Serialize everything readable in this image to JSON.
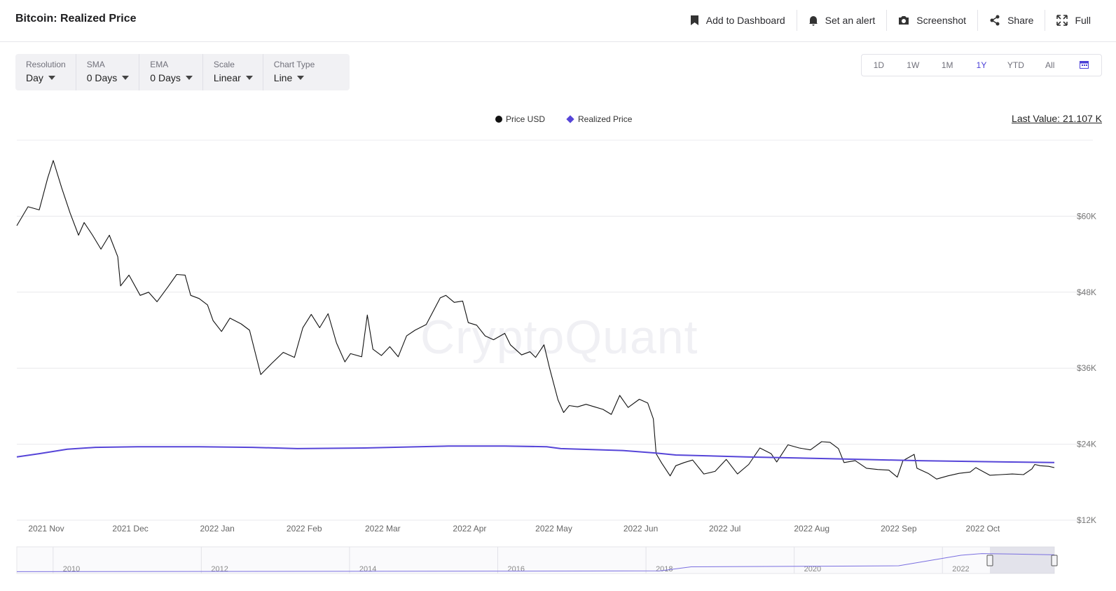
{
  "header": {
    "title": "Bitcoin: Realized Price",
    "actions": [
      {
        "label": "Add to Dashboard",
        "icon": "bookmark-icon"
      },
      {
        "label": "Set an alert",
        "icon": "bell-icon"
      },
      {
        "label": "Screenshot",
        "icon": "camera-icon"
      },
      {
        "label": "Share",
        "icon": "share-icon"
      },
      {
        "label": "Full",
        "icon": "expand-icon"
      }
    ]
  },
  "controls": [
    {
      "label": "Resolution",
      "value": "Day"
    },
    {
      "label": "SMA",
      "value": "0 Days"
    },
    {
      "label": "EMA",
      "value": "0 Days"
    },
    {
      "label": "Scale",
      "value": "Linear"
    },
    {
      "label": "Chart Type",
      "value": "Line"
    }
  ],
  "ranges": {
    "options": [
      "1D",
      "1W",
      "1M",
      "1Y",
      "YTD",
      "All"
    ],
    "active": "1Y",
    "calendar_icon": "calendar-icon",
    "accent": "#4a3fd6"
  },
  "legend": {
    "price": "Price USD",
    "realized": "Realized Price",
    "price_color": "#111111",
    "realized_color": "#5645d8"
  },
  "last_value": "Last Value: 21.107 K",
  "watermark": "CryptoQuant",
  "chart_data": {
    "type": "line",
    "x_ticks": [
      "2021 Nov",
      "2021 Dec",
      "2022 Jan",
      "2022 Feb",
      "2022 Mar",
      "2022 Apr",
      "2022 May",
      "2022 Jun",
      "2022 Jul",
      "2022 Aug",
      "2022 Sep",
      "2022 Oct"
    ],
    "y_ticks": [
      "$12K",
      "$24K",
      "$36K",
      "$48K",
      "$60K"
    ],
    "ylim": [
      12000,
      72000
    ],
    "x_range": [
      "2021-10-28",
      "2022-11-02"
    ],
    "grid": true,
    "legend_position": "top-center",
    "series": [
      {
        "name": "Price USD",
        "color": "#111111",
        "points": [
          [
            "2021-10-28",
            58500
          ],
          [
            "2021-11-01",
            61500
          ],
          [
            "2021-11-05",
            61000
          ],
          [
            "2021-11-08",
            66000
          ],
          [
            "2021-11-10",
            68800
          ],
          [
            "2021-11-13",
            64500
          ],
          [
            "2021-11-16",
            60500
          ],
          [
            "2021-11-19",
            57000
          ],
          [
            "2021-11-21",
            59000
          ],
          [
            "2021-11-24",
            57000
          ],
          [
            "2021-11-27",
            54800
          ],
          [
            "2021-11-30",
            57000
          ],
          [
            "2021-12-03",
            53600
          ],
          [
            "2021-12-04",
            49000
          ],
          [
            "2021-12-07",
            50700
          ],
          [
            "2021-12-11",
            47500
          ],
          [
            "2021-12-14",
            48000
          ],
          [
            "2021-12-17",
            46500
          ],
          [
            "2021-12-21",
            48900
          ],
          [
            "2021-12-24",
            50800
          ],
          [
            "2021-12-27",
            50700
          ],
          [
            "2021-12-29",
            47500
          ],
          [
            "2022-01-01",
            47000
          ],
          [
            "2022-01-04",
            46000
          ],
          [
            "2022-01-06",
            43500
          ],
          [
            "2022-01-09",
            41800
          ],
          [
            "2022-01-12",
            43900
          ],
          [
            "2022-01-16",
            43000
          ],
          [
            "2022-01-19",
            42000
          ],
          [
            "2022-01-21",
            38500
          ],
          [
            "2022-01-23",
            35000
          ],
          [
            "2022-01-27",
            36800
          ],
          [
            "2022-01-31",
            38500
          ],
          [
            "2022-02-04",
            37700
          ],
          [
            "2022-02-07",
            42400
          ],
          [
            "2022-02-10",
            44500
          ],
          [
            "2022-02-13",
            42400
          ],
          [
            "2022-02-16",
            44600
          ],
          [
            "2022-02-19",
            40000
          ],
          [
            "2022-02-22",
            37000
          ],
          [
            "2022-02-24",
            38300
          ],
          [
            "2022-02-28",
            37800
          ],
          [
            "2022-03-02",
            44400
          ],
          [
            "2022-03-04",
            39000
          ],
          [
            "2022-03-07",
            38000
          ],
          [
            "2022-03-10",
            39400
          ],
          [
            "2022-03-13",
            37800
          ],
          [
            "2022-03-16",
            41100
          ],
          [
            "2022-03-19",
            42000
          ],
          [
            "2022-03-23",
            42900
          ],
          [
            "2022-03-28",
            47100
          ],
          [
            "2022-03-30",
            47500
          ],
          [
            "2022-04-02",
            46400
          ],
          [
            "2022-04-05",
            46600
          ],
          [
            "2022-04-07",
            43200
          ],
          [
            "2022-04-10",
            42800
          ],
          [
            "2022-04-13",
            41100
          ],
          [
            "2022-04-16",
            40500
          ],
          [
            "2022-04-20",
            41500
          ],
          [
            "2022-04-22",
            39700
          ],
          [
            "2022-04-26",
            38100
          ],
          [
            "2022-04-29",
            38600
          ],
          [
            "2022-05-01",
            37700
          ],
          [
            "2022-05-04",
            39700
          ],
          [
            "2022-05-06",
            36000
          ],
          [
            "2022-05-09",
            31000
          ],
          [
            "2022-05-11",
            29000
          ],
          [
            "2022-05-13",
            30100
          ],
          [
            "2022-05-16",
            29900
          ],
          [
            "2022-05-19",
            30300
          ],
          [
            "2022-05-22",
            29900
          ],
          [
            "2022-05-25",
            29500
          ],
          [
            "2022-05-28",
            28700
          ],
          [
            "2022-05-31",
            31700
          ],
          [
            "2022-06-03",
            29800
          ],
          [
            "2022-06-07",
            31100
          ],
          [
            "2022-06-10",
            30500
          ],
          [
            "2022-06-12",
            28000
          ],
          [
            "2022-06-13",
            22500
          ],
          [
            "2022-06-15",
            21000
          ],
          [
            "2022-06-18",
            19000
          ],
          [
            "2022-06-20",
            20600
          ],
          [
            "2022-06-23",
            21100
          ],
          [
            "2022-06-26",
            21500
          ],
          [
            "2022-06-30",
            19300
          ],
          [
            "2022-07-04",
            19700
          ],
          [
            "2022-07-08",
            21600
          ],
          [
            "2022-07-12",
            19300
          ],
          [
            "2022-07-16",
            20800
          ],
          [
            "2022-07-20",
            23400
          ],
          [
            "2022-07-24",
            22500
          ],
          [
            "2022-07-26",
            21200
          ],
          [
            "2022-07-30",
            23900
          ],
          [
            "2022-08-03",
            23400
          ],
          [
            "2022-08-07",
            23100
          ],
          [
            "2022-08-11",
            24400
          ],
          [
            "2022-08-14",
            24300
          ],
          [
            "2022-08-17",
            23300
          ],
          [
            "2022-08-19",
            21100
          ],
          [
            "2022-08-23",
            21400
          ],
          [
            "2022-08-27",
            20200
          ],
          [
            "2022-08-31",
            20000
          ],
          [
            "2022-09-04",
            19900
          ],
          [
            "2022-09-07",
            18800
          ],
          [
            "2022-09-09",
            21400
          ],
          [
            "2022-09-13",
            22400
          ],
          [
            "2022-09-14",
            20200
          ],
          [
            "2022-09-18",
            19400
          ],
          [
            "2022-09-21",
            18500
          ],
          [
            "2022-09-25",
            19000
          ],
          [
            "2022-09-29",
            19400
          ],
          [
            "2022-10-03",
            19600
          ],
          [
            "2022-10-05",
            20300
          ],
          [
            "2022-10-10",
            19100
          ],
          [
            "2022-10-14",
            19200
          ],
          [
            "2022-10-18",
            19300
          ],
          [
            "2022-10-22",
            19200
          ],
          [
            "2022-10-25",
            20100
          ],
          [
            "2022-10-26",
            20800
          ],
          [
            "2022-10-28",
            20600
          ],
          [
            "2022-10-31",
            20500
          ],
          [
            "2022-11-02",
            20300
          ]
        ]
      },
      {
        "name": "Realized Price",
        "color": "#5645d8",
        "points": [
          [
            "2021-10-28",
            22000
          ],
          [
            "2021-11-05",
            22500
          ],
          [
            "2021-11-15",
            23200
          ],
          [
            "2021-11-25",
            23500
          ],
          [
            "2021-12-10",
            23600
          ],
          [
            "2022-01-01",
            23600
          ],
          [
            "2022-01-20",
            23500
          ],
          [
            "2022-02-05",
            23300
          ],
          [
            "2022-03-01",
            23400
          ],
          [
            "2022-03-31",
            23700
          ],
          [
            "2022-04-20",
            23700
          ],
          [
            "2022-05-05",
            23600
          ],
          [
            "2022-05-10",
            23300
          ],
          [
            "2022-06-01",
            23000
          ],
          [
            "2022-06-13",
            22600
          ],
          [
            "2022-06-20",
            22300
          ],
          [
            "2022-07-15",
            22000
          ],
          [
            "2022-08-15",
            21700
          ],
          [
            "2022-09-15",
            21400
          ],
          [
            "2022-10-15",
            21200
          ],
          [
            "2022-11-02",
            21107
          ]
        ]
      }
    ],
    "navigator": {
      "labels": [
        "2010",
        "2012",
        "2014",
        "2016",
        "2018",
        "2020",
        "2022"
      ]
    }
  }
}
